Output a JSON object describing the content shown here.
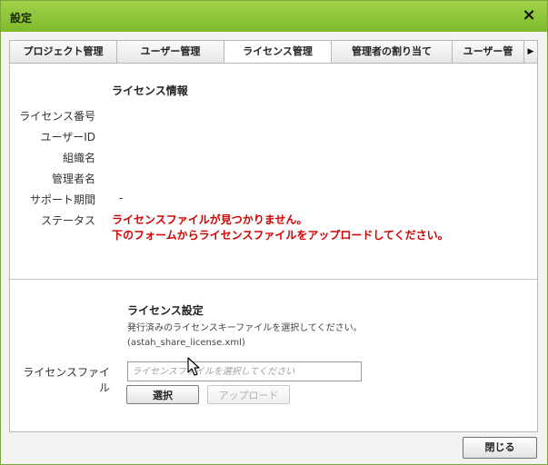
{
  "window": {
    "title": "設定",
    "close_label": "×"
  },
  "tabs": [
    {
      "label": "プロジェクト管理"
    },
    {
      "label": "ユーザー管理"
    },
    {
      "label": "ライセンス管理",
      "active": true
    },
    {
      "label": "管理者の割り当て"
    },
    {
      "label": "ユーザー管"
    }
  ],
  "tab_scroll_icon": "▶",
  "license_info": {
    "title": "ライセンス情報",
    "rows": [
      {
        "label": "ライセンス番号",
        "value": ""
      },
      {
        "label": "ユーザーID",
        "value": ""
      },
      {
        "label": "組織名",
        "value": ""
      },
      {
        "label": "管理者名",
        "value": ""
      },
      {
        "label": "サポート期間",
        "value": "-"
      }
    ],
    "status_label": "ステータス",
    "status_line1": "ライセンスファイルが見つかりません。",
    "status_line2": "下のフォームからライセンスファイルをアップロードしてください。",
    "status_color": "#d40000"
  },
  "license_settings": {
    "title": "ライセンス設定",
    "desc_line1": "発行済みのライセンスキーファイルを選択してください。",
    "desc_line2": "(astah_share_license.xml)",
    "file_label": "ライセンスファイル",
    "file_placeholder": "ライセンスファイルを選択してください",
    "select_button": "選択",
    "upload_button": "アップロード"
  },
  "footer": {
    "close_button": "閉じる"
  },
  "colors": {
    "titlebar": "#8cc53a",
    "accent_border": "#7aa63a"
  }
}
